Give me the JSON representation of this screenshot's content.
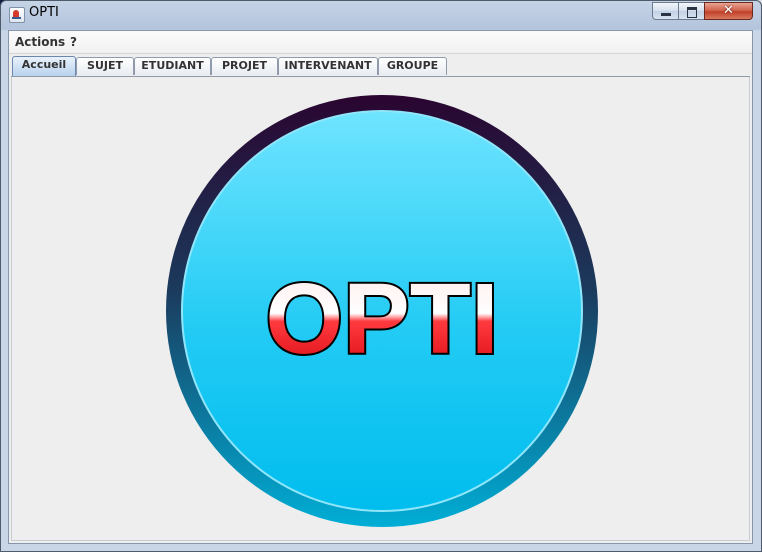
{
  "window": {
    "title": "OPTI",
    "close_glyph": "✕"
  },
  "menubar": {
    "items": [
      {
        "label": "Actions"
      },
      {
        "label": "?"
      }
    ]
  },
  "tabs": [
    {
      "label": "Accueil",
      "active": true
    },
    {
      "label": "SUJET",
      "active": false
    },
    {
      "label": "ETUDIANT",
      "active": false
    },
    {
      "label": "PROJET",
      "active": false
    },
    {
      "label": "INTERVENANT",
      "active": false
    },
    {
      "label": "GROUPE",
      "active": false
    }
  ],
  "home": {
    "logo_text": "OPTI"
  },
  "colors": {
    "ring_dark": "#2a0a2e",
    "ring_light": "#0aa3c8",
    "disc_top": "#6ae2ff",
    "disc_bottom": "#00c0ee",
    "logo_red": "#e8141e"
  },
  "icons": {
    "app": "java-cup-icon",
    "minimize": "minimize-icon",
    "maximize": "maximize-icon",
    "close": "close-icon"
  }
}
